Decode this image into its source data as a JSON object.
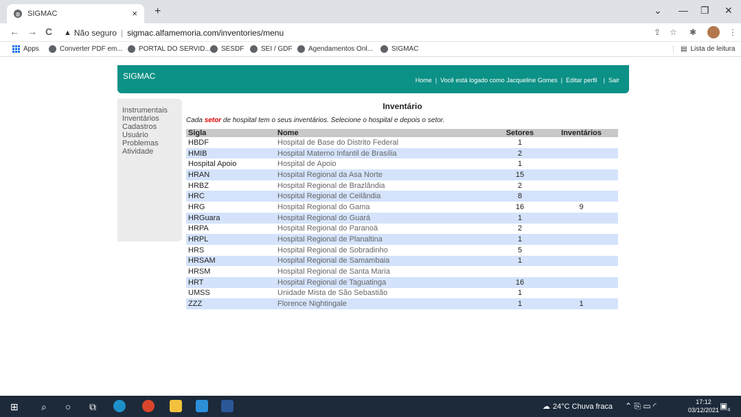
{
  "browser": {
    "tab_title": "SIGMAC",
    "tab_close": "×",
    "new_tab": "+",
    "min": "—",
    "restore": "❐",
    "close": "✕",
    "back": "←",
    "forward": "→",
    "reload": "C",
    "security_text": "Não seguro",
    "url": "sigmac.alfamemoria.com/inventories/menu",
    "bookmarks": [
      {
        "label": "Apps"
      },
      {
        "label": "Converter PDF em..."
      },
      {
        "label": "PORTAL DO SERVID..."
      },
      {
        "label": "SESDF"
      },
      {
        "label": "SEI / GDF"
      },
      {
        "label": "Agendamentos Onl..."
      },
      {
        "label": "SIGMAC"
      }
    ],
    "reading_list": "Lista de leitura"
  },
  "header": {
    "brand": "SIGMAC",
    "nav_home": "Home",
    "logged_text": "Você está logado como Jacqueline Gomes",
    "nav_edit": "Editar perfil",
    "nav_exit": "Sair"
  },
  "sidebar": {
    "items": [
      {
        "label": "Instrumentais"
      },
      {
        "label": "Inventários"
      },
      {
        "label": "Cadastros"
      },
      {
        "label": "Usuário"
      },
      {
        "label": "Problemas"
      },
      {
        "label": "Atividade"
      }
    ]
  },
  "main": {
    "title": "Inventário",
    "desc_pre": "Cada ",
    "desc_hl": "setor",
    "desc_post": " de hospital tem o seus inventários. Selecione o hospital e depois o setor.",
    "columns": [
      "Sigla",
      "Nome",
      "Setores",
      "Inventários"
    ],
    "rows": [
      {
        "sigla": "HBDF",
        "nome": "Hospital de Base do Distrito Federal",
        "setores": "1",
        "inventarios": ""
      },
      {
        "sigla": "HMIB",
        "nome": "Hospital Materno Infantil de Brasília",
        "setores": "2",
        "inventarios": ""
      },
      {
        "sigla": "Hospital Apoio",
        "nome": "Hospital de Apoio",
        "setores": "1",
        "inventarios": ""
      },
      {
        "sigla": "HRAN",
        "nome": "Hospital Regional da Asa Norte",
        "setores": "15",
        "inventarios": ""
      },
      {
        "sigla": "HRBZ",
        "nome": "Hospital Regional de Brazlândia",
        "setores": "2",
        "inventarios": ""
      },
      {
        "sigla": "HRC",
        "nome": "Hospital Regional de Ceilândia",
        "setores": "8",
        "inventarios": ""
      },
      {
        "sigla": "HRG",
        "nome": "Hospital Regional do Gama",
        "setores": "16",
        "inventarios": "9"
      },
      {
        "sigla": "HRGuara",
        "nome": "Hospital Regional do Guará",
        "setores": "1",
        "inventarios": ""
      },
      {
        "sigla": "HRPA",
        "nome": "Hospital Regional do Paranoá",
        "setores": "2",
        "inventarios": ""
      },
      {
        "sigla": "HRPL",
        "nome": "Hospital Regional de Planaltina",
        "setores": "1",
        "inventarios": ""
      },
      {
        "sigla": "HRS",
        "nome": "Hospital Regional de Sobradinho",
        "setores": "5",
        "inventarios": ""
      },
      {
        "sigla": "HRSAM",
        "nome": "Hospital Regional de Samambaia",
        "setores": "1",
        "inventarios": ""
      },
      {
        "sigla": "HRSM",
        "nome": "Hospital Regional de Santa Maria",
        "setores": "",
        "inventarios": ""
      },
      {
        "sigla": "HRT",
        "nome": "Hospital Regional de Taguatinga",
        "setores": "16",
        "inventarios": ""
      },
      {
        "sigla": "UMSS",
        "nome": "Unidade Mista de São Sebastião",
        "setores": "1",
        "inventarios": ""
      },
      {
        "sigla": "ZZZ",
        "nome": "Florence Nightingale",
        "setores": "1",
        "inventarios": "1"
      }
    ]
  },
  "taskbar": {
    "weather": "24°C  Chuva fraca",
    "time": "17:12",
    "date": "03/12/2021",
    "notif_count": "4"
  },
  "colors": {
    "header_bg": "#0c9186",
    "row_alt": "#d4e3fb",
    "highlight": "#dd0000"
  }
}
